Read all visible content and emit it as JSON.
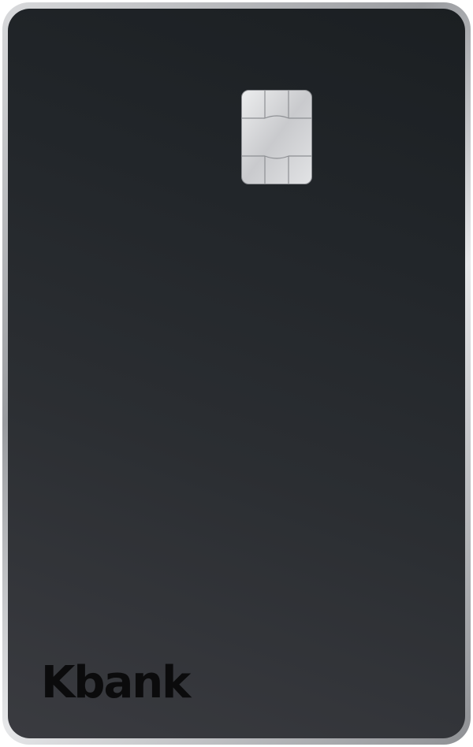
{
  "card": {
    "brand_label": "Kbank",
    "colors": {
      "face_top": "#1b1f22",
      "face_bottom": "#3a3b40",
      "rim": "#9a9ca0",
      "chip": "#d8d9db",
      "brand_text": "#0b0b0c"
    },
    "icons": {
      "chip": "emv-chip-icon"
    }
  }
}
